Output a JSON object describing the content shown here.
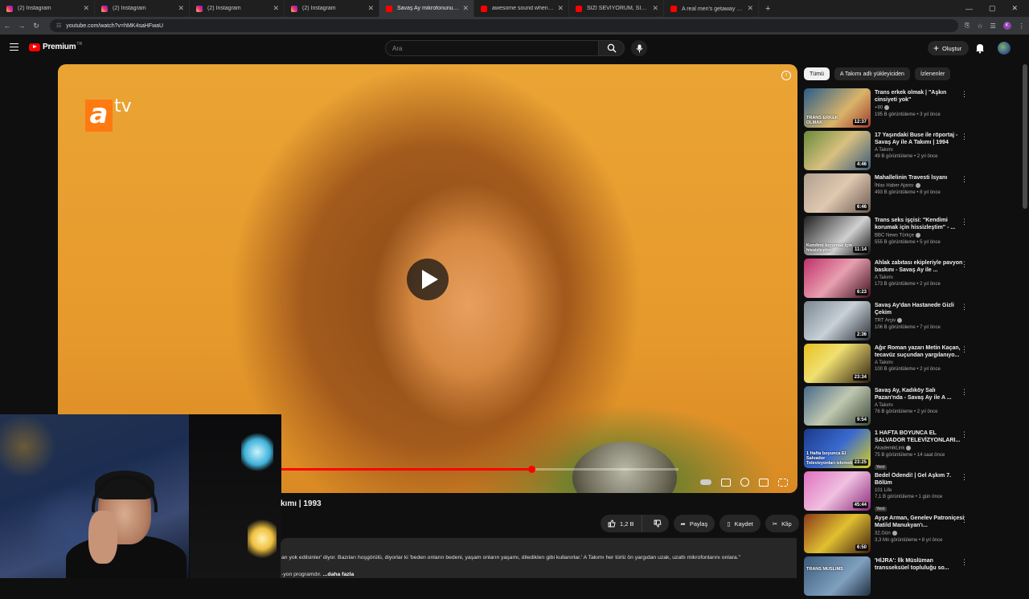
{
  "browser": {
    "tabs": [
      {
        "title": "(2) Instagram",
        "icon": "instagram-icon",
        "active": false
      },
      {
        "title": "(2) Instagram",
        "icon": "instagram-icon",
        "active": false
      },
      {
        "title": "(2) Instagram",
        "icon": "instagram-icon",
        "active": false
      },
      {
        "title": "(2) Instagram",
        "icon": "instagram-icon",
        "active": false
      },
      {
        "title": "Savaş Ay mikrofonunu trav...",
        "icon": "youtube-icon",
        "active": true
      },
      {
        "title": "awesome sound when mammoth...",
        "icon": "youtube-icon",
        "active": false
      },
      {
        "title": "SİZİ SEVİYORUM, SİZİ SEVİYORUM...",
        "icon": "youtube-icon",
        "active": false
      },
      {
        "title": "A real men's getaway 😍 #food...",
        "icon": "youtube-icon",
        "active": false
      }
    ],
    "url": "youtube.com/watch?v=hMK4saHFwaU"
  },
  "header": {
    "logo_text": "Premium",
    "logo_region": "TR",
    "search_placeholder": "Ara",
    "create_label": "Oluştur"
  },
  "player": {
    "channel_logo_a": "a",
    "channel_logo_tv": "tv",
    "progress": 0.63,
    "accent": "#ff0000"
  },
  "video": {
    "title_partial": "kımı | 1993",
    "like_count": "1,2 B",
    "share_label": "Paylaş",
    "save_label": "Kaydet",
    "clip_label": "Klip",
    "description_line1": "an yok edilsinler' diyor. Bazıları hoşgörülü, diyorlar ki 'beden onların bedeni, yaşam onların yaşamı, dilediklerı gibi kullanırlar.' A Takımı her türlü ön yargıdan uzak, uzattı mikrofonlarını onlara.\"",
    "description_line2": "-yon programdır. ",
    "description_more": "...daha fazla"
  },
  "sidebar": {
    "chips": [
      "Tümü",
      "A Takımı adlı yükleyiciden",
      "İzlenenler"
    ],
    "items": [
      {
        "title": "Trans erkek olmak | \"Aşkın cinsiyeti yok\"",
        "channel": "+90",
        "verified": true,
        "views": "195 B görüntüleme • 3 yıl önce",
        "duration": "12:37",
        "badge": "",
        "thumb_bg": "linear-gradient(135deg,#2a5d8a,#d9b46a 60%,#a03a2c)"
      },
      {
        "title": "17 Yaşındaki Buse ile röportaj - Savaş Ay ile A Takımı | 1994",
        "channel": "A Takımı",
        "verified": false,
        "views": "49 B görüntüleme • 2 yıl önce",
        "duration": "4:46",
        "badge": "",
        "thumb_bg": "linear-gradient(135deg,#6a8a3a,#d8c080 50%,#3a5a7a)"
      },
      {
        "title": "Mahallelinin Travesti İsyanı",
        "channel": "İhlas Haber Ajansı",
        "verified": true,
        "views": "493 B görüntüleme • 8 yıl önce",
        "duration": "6:46",
        "badge": "",
        "thumb_bg": "linear-gradient(135deg,#b0a090,#e0c8b0 50%,#6a5a50)"
      },
      {
        "title": "Trans seks işçisi: \"Kendimi korumak için hissizleştim\" - ...",
        "channel": "BBC News Türkçe",
        "verified": true,
        "views": "555 B görüntüleme • 5 yıl önce",
        "duration": "11:14",
        "badge": "",
        "thumb_bg": "linear-gradient(135deg,#202020,#d0d0d0 60%,#101010)"
      },
      {
        "title": "Ahlak zabıtası ekipleriyle pavyon baskını - Savaş Ay ile ...",
        "channel": "A Takımı",
        "verified": false,
        "views": "173 B görüntüleme • 2 yıl önce",
        "duration": "6:23",
        "badge": "",
        "thumb_bg": "linear-gradient(135deg,#c0306a,#e8a0b0 50%,#401020)"
      },
      {
        "title": "Savaş Ay'dan Hastanede Gizli Çekim",
        "channel": "TRT Arşiv",
        "verified": true,
        "views": "106 B görüntüleme • 7 yıl önce",
        "duration": "2:36",
        "badge": "",
        "thumb_bg": "linear-gradient(135deg,#7a8890,#c8d0d8 50%,#2a3038)"
      },
      {
        "title": "Ağır Roman yazarı Metin Kaçan, tecavüz suçundan yargılanıyo...",
        "channel": "A Takımı",
        "verified": false,
        "views": "100 B görüntüleme • 2 yıl önce",
        "duration": "23:34",
        "badge": "",
        "thumb_bg": "linear-gradient(135deg,#e8c020,#f0e070 40%,#302010)"
      },
      {
        "title": "Savaş Ay, Kadıköy Salı Pazarı'nda - Savaş Ay ile A ...",
        "channel": "A Takımı",
        "verified": false,
        "views": "76 B görüntüleme • 2 yıl önce",
        "duration": "9:54",
        "badge": "",
        "thumb_bg": "linear-gradient(135deg,#4a6a8a,#c0c8b0 50%,#3a4a3a)"
      },
      {
        "title": "1 HAFTA BOYUNCA EL SALVADOR TELEVİZYONLARI...",
        "channel": "AkademikLink",
        "verified": true,
        "views": "75 B görüntüleme • 14 saat önce",
        "duration": "23:25",
        "badge": "Yeni",
        "thumb_bg": "linear-gradient(135deg,#1a3a8a,#3a6ad0 50%,#d8d020)"
      },
      {
        "title": "Bedel Ödendi! | Gel Aşkım 7. Bölüm",
        "channel": "101 Life",
        "verified": false,
        "views": "7,1 B görüntüleme • 1 gün önce",
        "duration": "45:44",
        "badge": "Yeni",
        "thumb_bg": "linear-gradient(135deg,#e070c0,#f0c0e0 50%,#8a2a7a)"
      },
      {
        "title": "Ayşe Arman, Genelev Patroniçesi Matild Manukyan'ı...",
        "channel": "32.Gün",
        "verified": true,
        "views": "3,3 Mn görüntüleme • 8 yıl önce",
        "duration": "6:50",
        "badge": "",
        "thumb_bg": "linear-gradient(135deg,#8a3a1a,#e0c030 50%,#402010)"
      },
      {
        "title": "'HİJRA': İlk Müslüman transseksüel topluluğu so...",
        "channel": "",
        "verified": false,
        "views": "",
        "duration": "",
        "badge": "",
        "thumb_bg": "linear-gradient(135deg,#3a5a7a,#80a0c0 60%,#203040)"
      }
    ],
    "thumb_captions": [
      "TRANS ERKEK OLMAK",
      "",
      "",
      "Kendimi korumak için hissizleştim",
      "",
      "",
      "",
      "",
      "1 Hafta boyunca El Salvador Televizyonları izlemek",
      "",
      "",
      "TRANS MUSLIMS"
    ]
  }
}
